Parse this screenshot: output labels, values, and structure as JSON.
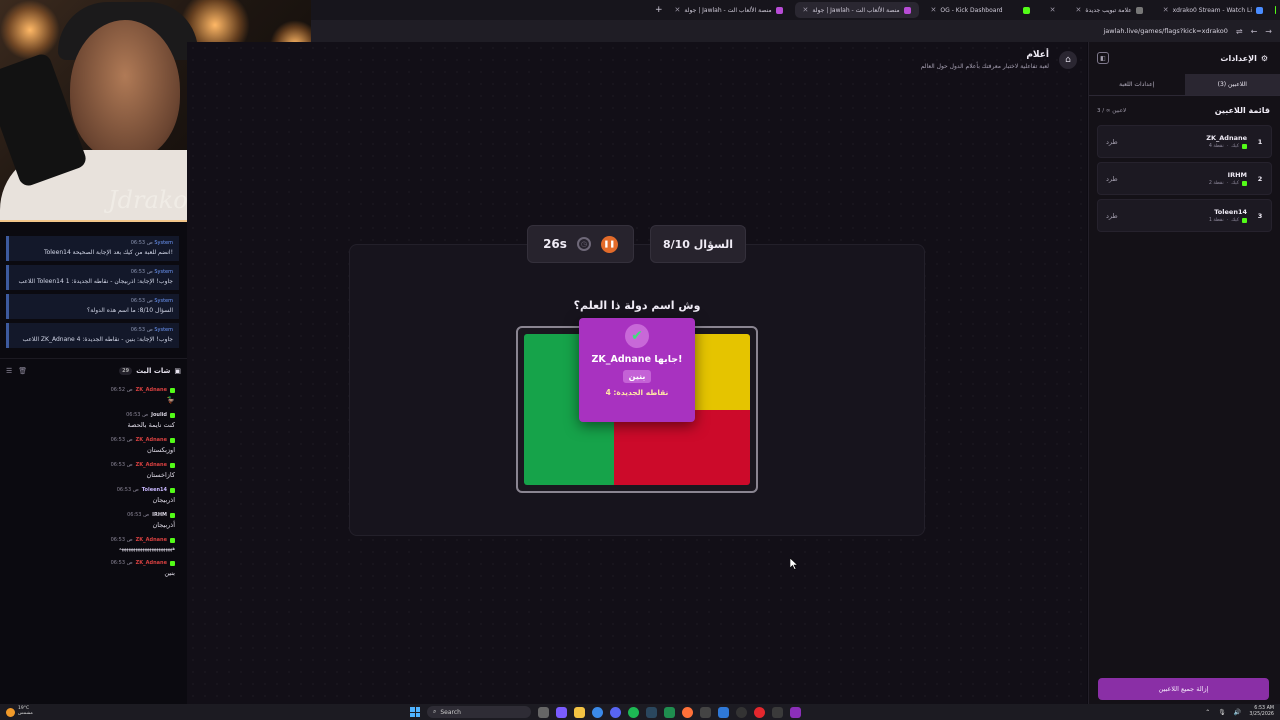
{
  "browser": {
    "tabs": [
      {
        "label": "xdrako0 Stream - Watch Li",
        "active": false
      },
      {
        "label": "علامة تبويب جديدة",
        "active": false
      },
      {
        "label": "",
        "active": false
      },
      {
        "label": "OG - Kick Dashboard",
        "active": false
      },
      {
        "label": "جولة | Jawlah - منصة الألعاب الت",
        "active": true
      },
      {
        "label": "جولة | Jawlah - منصة الألعاب الت",
        "active": false
      }
    ],
    "url": "jawlah.live/games/flags?kick=xdrako0"
  },
  "stream": {
    "system_messages": [
      {
        "author": "System",
        "time": "06:53 ص",
        "text": "Toleen14 انضم للعبة من كيك بعد الإجابة الصحيحة!"
      },
      {
        "author": "System",
        "time": "06:53 ص",
        "text": "اللاعب Toleen14 جاوب! الإجابة: اذربيجان - نقاطه الجديدة: 1"
      },
      {
        "author": "System",
        "time": "06:53 ص",
        "text": "السؤال 8/10: ما اسم هذه الدولة؟"
      },
      {
        "author": "System",
        "time": "06:53 ص",
        "text": "اللاعب ZK_Adnane جاوب! الإجابة: بنين - نقاطه الجديدة: 4"
      }
    ],
    "chat_title": "شات البث",
    "chat_count": "29",
    "messages": [
      {
        "user": "ZK_Adnane",
        "time": "06:52 ص",
        "text": "🦆",
        "color": "red"
      },
      {
        "user": "Joulid",
        "time": "06:53 ص",
        "text": "كنت نايمة بالحصة",
        "color": "white"
      },
      {
        "user": "ZK_Adnane",
        "time": "06:53 ص",
        "text": "اوزبكستان",
        "color": "red"
      },
      {
        "user": "ZK_Adnane",
        "time": "06:53 ص",
        "text": "كازاخستان",
        "color": "red"
      },
      {
        "user": "Toleen14",
        "time": "06:53 ص",
        "text": "اذربيجان",
        "color": "teal"
      },
      {
        "user": "IRHM",
        "time": "06:53 ص",
        "text": "أذربيجان",
        "color": "white"
      },
      {
        "user": "ZK_Adnane",
        "time": "06:53 ص",
        "text": "هههههههههههههههههههههههه",
        "color": "red"
      },
      {
        "user": "ZK_Adnane",
        "time": "06:53 ص",
        "text": "بنين",
        "color": "red"
      }
    ],
    "signature": "Jdrako"
  },
  "game": {
    "title": "أعلام",
    "subtitle": "لعبة تفاعلية لاختبار معرفتك بأعلام الدول حول العالم",
    "timer": "26s",
    "question_counter": "السؤال 8/10",
    "question": "وش اسم دولة ذا العلم؟",
    "answer_popup": {
      "who": "ZK_Adnane جابها!",
      "country": "بنين",
      "points": "نقاطه الجديدة: 4"
    },
    "flag_colors": {
      "green": "#16a34a",
      "yellow": "#e5c400",
      "red": "#cc0a2a"
    }
  },
  "settings": {
    "title": "الإعدادات",
    "tabs": [
      {
        "label": "اللاعبين (3)",
        "active": true
      },
      {
        "label": "إعدادات اللعبة",
        "active": false
      }
    ],
    "list_title": "قائمة اللاعبين",
    "list_count": "3 / ∞ لاعبين",
    "players": [
      {
        "rank": "1",
        "name": "ZK_Adnane",
        "source": "كيك",
        "points": "4 نقطة",
        "kick": "طرد"
      },
      {
        "rank": "2",
        "name": "IRHM",
        "source": "كيك",
        "points": "2 نقطة",
        "kick": "طرد"
      },
      {
        "rank": "3",
        "name": "Toleen14",
        "source": "كيك",
        "points": "1 نقطة",
        "kick": "طرد"
      }
    ],
    "remove_all": "إزالة جميع اللاعبين"
  },
  "taskbar": {
    "weather_temp": "19°C",
    "weather_desc": "مشمس",
    "search": "Search",
    "time": "6:53 AM",
    "date": "3/25/2026"
  }
}
